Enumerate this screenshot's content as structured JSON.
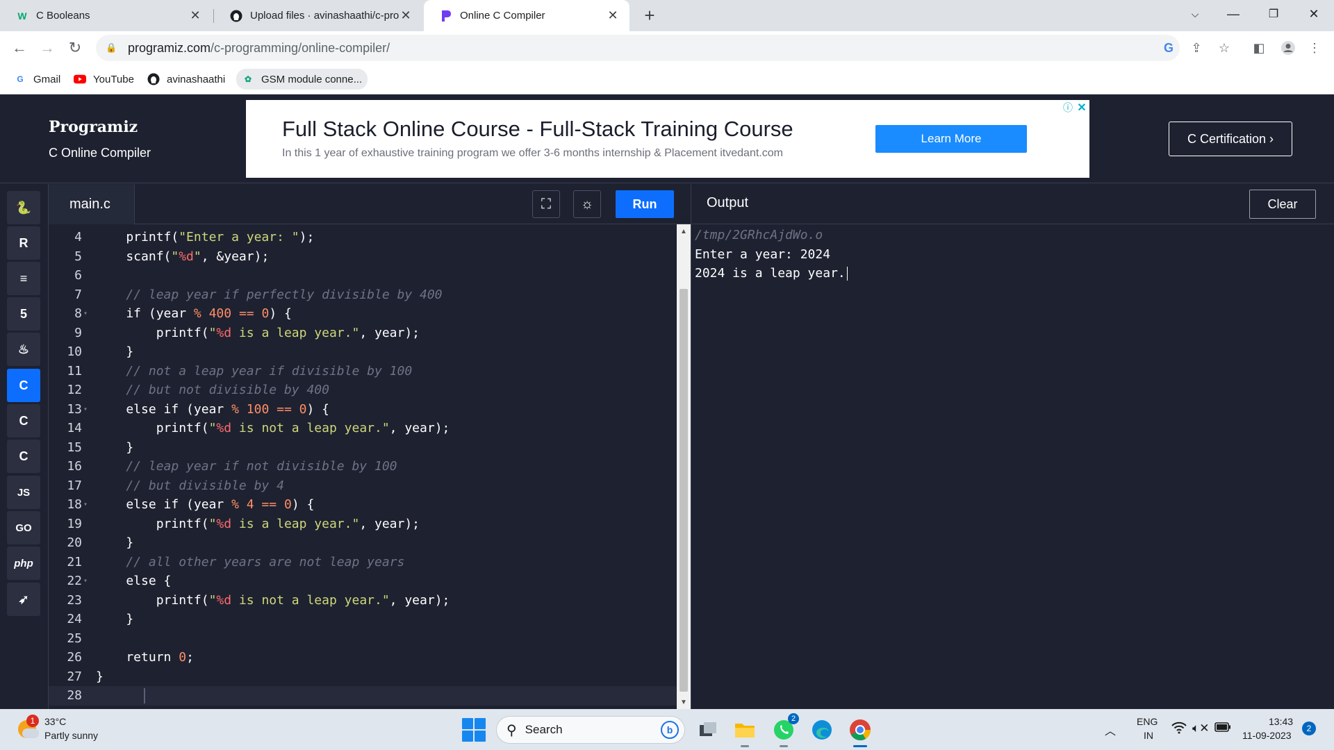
{
  "browser": {
    "tabs": [
      {
        "label": "C Booleans",
        "favicon": "W"
      },
      {
        "label": "Upload files · avinashaathi/c-proc",
        "favicon": "github-icon"
      },
      {
        "label": "Online C Compiler",
        "favicon": "programiz-icon",
        "active": true
      }
    ],
    "new_tab_symbol": "+",
    "url_host": "programiz.com",
    "url_path": "/c-programming/online-compiler/",
    "bookmarks": [
      {
        "label": "Gmail"
      },
      {
        "label": "YouTube"
      },
      {
        "label": "avinashaathi"
      },
      {
        "label": "GSM module conne..."
      }
    ]
  },
  "site": {
    "logo": "Programiz",
    "subtitle": "C Online Compiler",
    "ad": {
      "title": "Full Stack Online Course - Full-Stack Training Course",
      "text": "In this 1 year of exhaustive training program we offer 3-6 months internship & Placement itvedant.com",
      "button": "Learn More"
    },
    "cert_button": "C Certification ›"
  },
  "languages": [
    {
      "name": "python-icon",
      "glyph": "🐍"
    },
    {
      "name": "r-icon",
      "glyph": "R"
    },
    {
      "name": "sql-icon",
      "glyph": "≡"
    },
    {
      "name": "html-icon",
      "glyph": "5"
    },
    {
      "name": "java-icon",
      "glyph": "♨"
    },
    {
      "name": "c-icon",
      "glyph": "C",
      "active": true
    },
    {
      "name": "cpp-icon",
      "glyph": "C"
    },
    {
      "name": "csharp-icon",
      "glyph": "C"
    },
    {
      "name": "js-icon",
      "glyph": "JS"
    },
    {
      "name": "go-icon",
      "glyph": "GO"
    },
    {
      "name": "php-icon",
      "glyph": "php"
    },
    {
      "name": "swift-icon",
      "glyph": "➶"
    }
  ],
  "editor": {
    "file_name": "main.c",
    "run_label": "Run",
    "lines": [
      {
        "n": "4",
        "code": "    printf(\"Enter a year: \");"
      },
      {
        "n": "5",
        "code": "    scanf(\"%d\", &year);"
      },
      {
        "n": "6",
        "code": ""
      },
      {
        "n": "7",
        "code": "    // leap year if perfectly divisible by 400"
      },
      {
        "n": "8",
        "code": "    if (year % 400 == 0) {",
        "fold": true
      },
      {
        "n": "9",
        "code": "        printf(\"%d is a leap year.\", year);"
      },
      {
        "n": "10",
        "code": "    }"
      },
      {
        "n": "11",
        "code": "    // not a leap year if divisible by 100"
      },
      {
        "n": "12",
        "code": "    // but not divisible by 400"
      },
      {
        "n": "13",
        "code": "    else if (year % 100 == 0) {",
        "fold": true
      },
      {
        "n": "14",
        "code": "        printf(\"%d is not a leap year.\", year);"
      },
      {
        "n": "15",
        "code": "    }"
      },
      {
        "n": "16",
        "code": "    // leap year if not divisible by 100"
      },
      {
        "n": "17",
        "code": "    // but divisible by 4"
      },
      {
        "n": "18",
        "code": "    else if (year % 4 == 0) {",
        "fold": true
      },
      {
        "n": "19",
        "code": "        printf(\"%d is a leap year.\", year);"
      },
      {
        "n": "20",
        "code": "    }"
      },
      {
        "n": "21",
        "code": "    // all other years are not leap years"
      },
      {
        "n": "22",
        "code": "    else {",
        "fold": true
      },
      {
        "n": "23",
        "code": "        printf(\"%d is not a leap year.\", year);"
      },
      {
        "n": "24",
        "code": "    }"
      },
      {
        "n": "25",
        "code": ""
      },
      {
        "n": "26",
        "code": "    return 0;"
      },
      {
        "n": "27",
        "code": "}"
      },
      {
        "n": "28",
        "code": "",
        "current": true
      }
    ]
  },
  "output": {
    "title": "Output",
    "clear_label": "Clear",
    "lines": [
      {
        "text": "/tmp/2GRhcAjdWo.o",
        "path": true
      },
      {
        "text": "Enter a year: 2024"
      },
      {
        "text": "2024 is a leap year."
      }
    ]
  },
  "taskbar": {
    "temperature": "33°C",
    "condition": "Partly sunny",
    "weather_badge": "1",
    "search_label": "Search",
    "whatsapp_badge": "2",
    "lang_top": "ENG",
    "lang_bottom": "IN",
    "time": "13:43",
    "date": "11-09-2023",
    "notifications": "2"
  },
  "colors": {
    "accent": "#0d6efd",
    "bg": "#1e2130",
    "comment": "#6e7386",
    "string": "#cdd87a",
    "number": "#ff8f66"
  }
}
